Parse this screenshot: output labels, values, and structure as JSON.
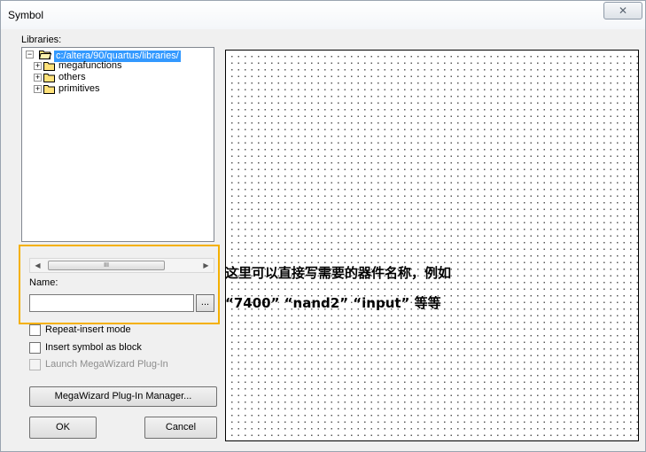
{
  "window": {
    "title": "Symbol",
    "close_glyph": "✕"
  },
  "libraries": {
    "label": "Libraries:",
    "root": "c:/altera/90/quartus/libraries/",
    "items": [
      "megafunctions",
      "others",
      "primitives"
    ],
    "scroll_grip": "III"
  },
  "name": {
    "label": "Name:",
    "value": "",
    "browse_label": "..."
  },
  "options": {
    "repeat_insert": "Repeat-insert mode",
    "insert_as_block": "Insert symbol as block",
    "launch_megawizard": "Launch MegaWizard Plug-In"
  },
  "buttons": {
    "megawizard_manager": "MegaWizard Plug-In Manager...",
    "ok": "OK",
    "cancel": "Cancel"
  },
  "annotation": {
    "line1": "这里可以直接写需要的器件名称，例如",
    "line2": "“7400” “nand2” “input” 等等"
  },
  "colors": {
    "highlight_border": "#f4b000",
    "selection": "#3399ff"
  }
}
